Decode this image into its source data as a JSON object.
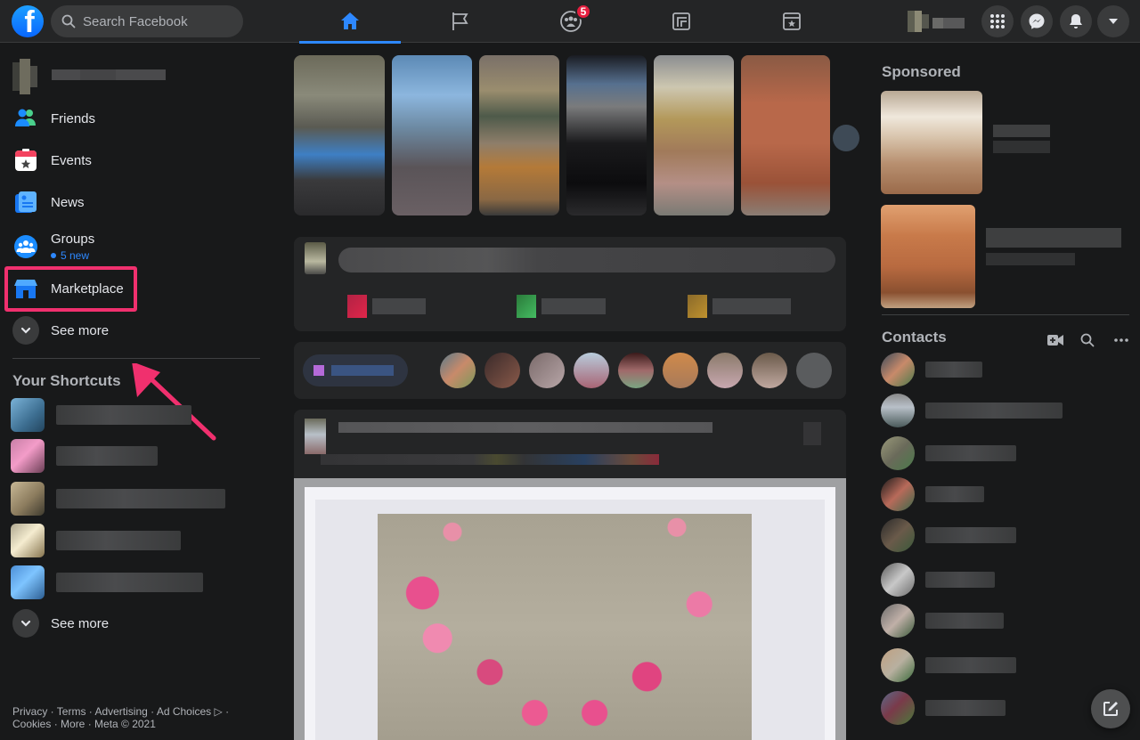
{
  "app": {
    "name": "Facebook"
  },
  "header": {
    "search_placeholder": "Search Facebook",
    "tabs": [
      {
        "name": "home",
        "icon": "home-icon",
        "active": true
      },
      {
        "name": "pages",
        "icon": "flag-icon",
        "active": false
      },
      {
        "name": "groups",
        "icon": "groups-icon",
        "active": false,
        "badge": "5"
      },
      {
        "name": "gaming",
        "icon": "gaming-icon",
        "active": false
      },
      {
        "name": "events",
        "icon": "calendar-star-icon",
        "active": false
      }
    ],
    "right_buttons": [
      "menu-grid-icon",
      "messenger-icon",
      "bell-icon",
      "caret-down-icon"
    ],
    "accent_color": "#2d88ff",
    "badge_color": "#e41e3f"
  },
  "sidebar": {
    "items": [
      {
        "label": "Friends",
        "icon": "friends-icon"
      },
      {
        "label": "Events",
        "icon": "calendar-icon"
      },
      {
        "label": "News",
        "icon": "news-icon"
      },
      {
        "label": "Groups",
        "icon": "groups-icon",
        "sub": "5 new"
      },
      {
        "label": "Marketplace",
        "icon": "marketplace-icon",
        "highlighted": true
      },
      {
        "label": "See more",
        "icon": "chevron-down-icon"
      }
    ],
    "shortcuts_title": "Your Shortcuts",
    "shortcuts_see_more": "See more",
    "highlight_color": "#f0306e"
  },
  "footer": {
    "line1": "Privacy · Terms · Advertising · Ad Choices ▷ ·",
    "line2": "Cookies · More · Meta © 2021"
  },
  "rightbar": {
    "sponsored_title": "Sponsored",
    "contacts_title": "Contacts",
    "contacts_icons": [
      "video-plus-icon",
      "search-icon",
      "more-icon"
    ]
  }
}
